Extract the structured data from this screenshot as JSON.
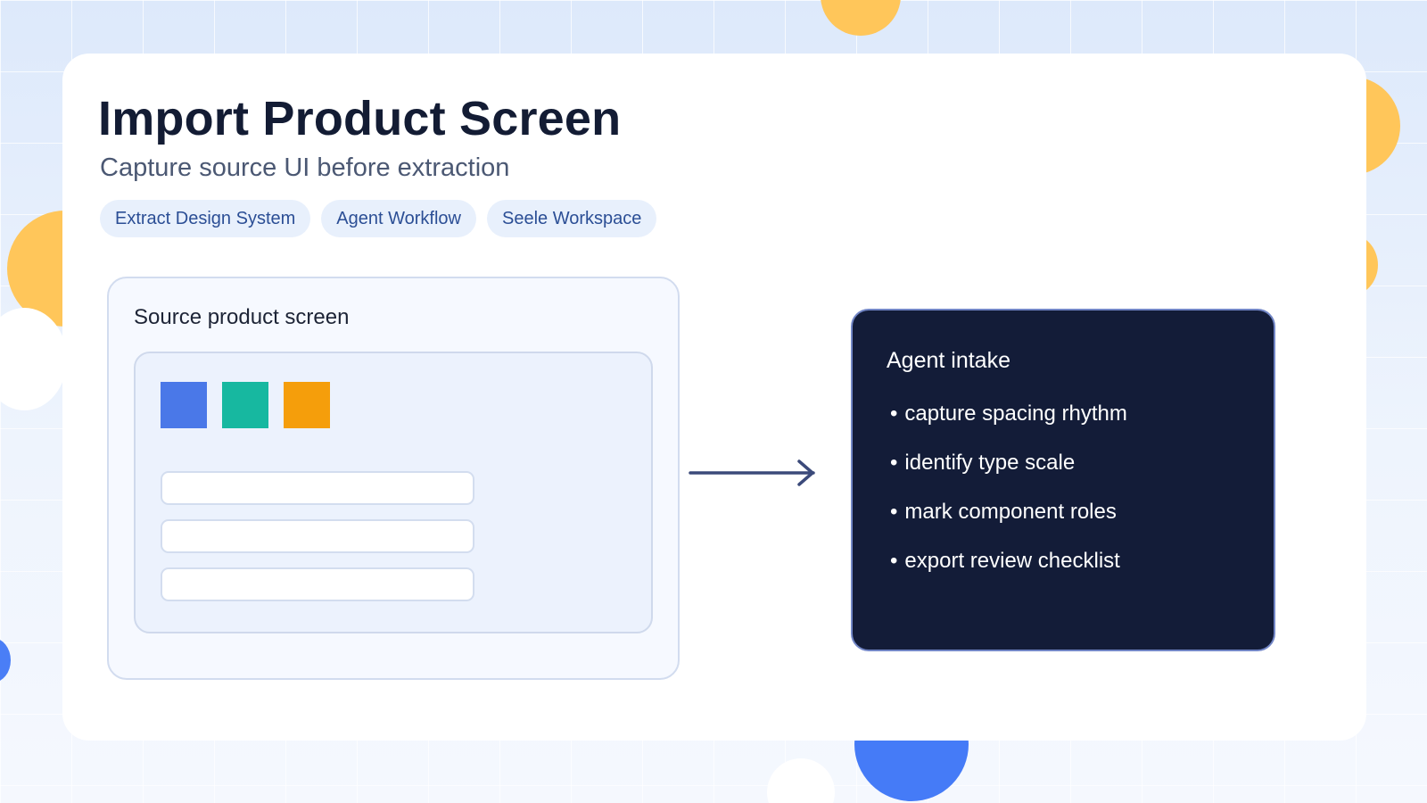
{
  "header": {
    "title": "Import Product Screen",
    "subtitle": "Capture source UI before extraction"
  },
  "tags": [
    {
      "label": "Extract Design System"
    },
    {
      "label": "Agent Workflow"
    },
    {
      "label": "Seele Workspace"
    }
  ],
  "source_panel": {
    "title": "Source product screen",
    "swatches": [
      "#4a78e8",
      "#17b8a0",
      "#f59e0b"
    ]
  },
  "agent_panel": {
    "title": "Agent intake",
    "bullet": "•",
    "items": [
      "capture spacing rhythm",
      "identify type scale",
      "mark component roles",
      "export review checklist"
    ]
  },
  "colors": {
    "accent_blue": "#457bf7",
    "accent_yellow": "#ffc65a",
    "navy": "#131c38"
  }
}
